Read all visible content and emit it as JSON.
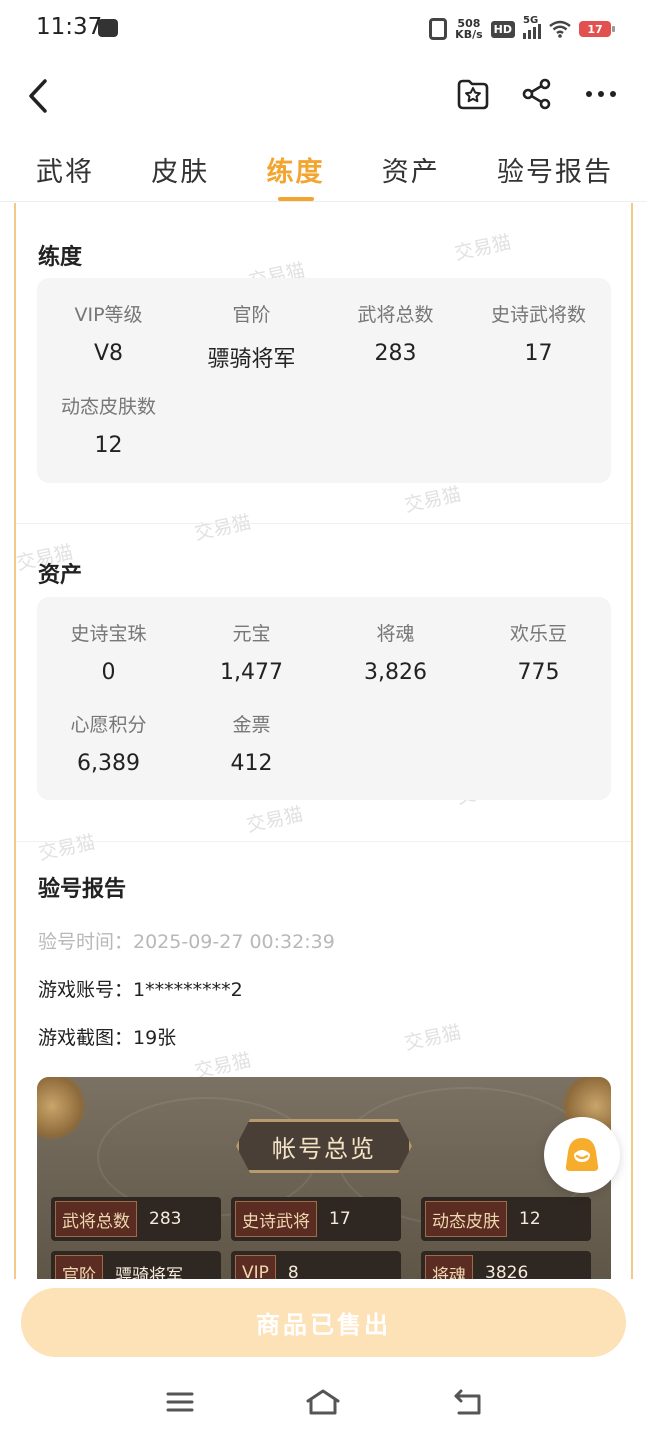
{
  "status_bar": {
    "time": "11:37",
    "net_speed_value": "508",
    "net_speed_unit": "KB/s",
    "hd_label": "HD",
    "network": "5G",
    "battery": "17"
  },
  "tabs": [
    {
      "label": "武将",
      "active": false
    },
    {
      "label": "皮肤",
      "active": false
    },
    {
      "label": "练度",
      "active": true
    },
    {
      "label": "资产",
      "active": false
    },
    {
      "label": "验号报告",
      "active": false
    }
  ],
  "training": {
    "title": "练度",
    "items": [
      {
        "label": "VIP等级",
        "value": "V8"
      },
      {
        "label": "官阶",
        "value": "骠骑将军"
      },
      {
        "label": "武将总数",
        "value": "283"
      },
      {
        "label": "史诗武将数",
        "value": "17"
      },
      {
        "label": "动态皮肤数",
        "value": "12"
      }
    ]
  },
  "assets": {
    "title": "资产",
    "items": [
      {
        "label": "史诗宝珠",
        "value": "0"
      },
      {
        "label": "元宝",
        "value": "1,477"
      },
      {
        "label": "将魂",
        "value": "3,826"
      },
      {
        "label": "欢乐豆",
        "value": "775"
      },
      {
        "label": "心愿积分",
        "value": "6,389"
      },
      {
        "label": "金票",
        "value": "412"
      }
    ]
  },
  "report": {
    "title": "验号报告",
    "time_line": "验号时间：2025-09-27 00:32:39",
    "account_line": "游戏账号：1*********2",
    "screenshots_line": "游戏截图：19张"
  },
  "screenshot": {
    "title": "帐号总览",
    "row1": [
      {
        "k": "武将总数",
        "v": "283"
      },
      {
        "k": "史诗武将",
        "v": "17"
      },
      {
        "k": "动态皮肤",
        "v": "12"
      }
    ],
    "row2": [
      {
        "k": "官阶",
        "v": "骠骑将军"
      },
      {
        "k": "VIP",
        "v": "8"
      },
      {
        "k": "将魂",
        "v": "3826"
      }
    ]
  },
  "watermark_text": "交易猫",
  "bottom": {
    "sold_label": "商品已售出"
  },
  "colors": {
    "accent": "#f2a630",
    "sold_button": "#fde1b7",
    "frame_border": "#f3c98a"
  },
  "icons": [
    "back-arrow-icon",
    "favorite-star-icon",
    "share-icon",
    "more-icon",
    "customer-service-icon",
    "menu-icon",
    "home-icon",
    "back-nav-icon"
  ]
}
